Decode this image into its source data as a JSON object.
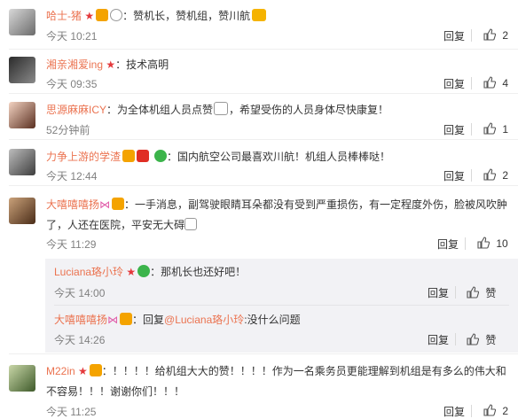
{
  "comments": [
    {
      "name": "哈士-猪",
      "text": "：赞机长，赞机组，赞川航",
      "time": "今天 10:21",
      "reply": "回复",
      "likes": "2"
    },
    {
      "name": "湘亲湘爱ing",
      "text": "：技术高明",
      "time": "今天 09:35",
      "reply": "回复",
      "likes": "4"
    },
    {
      "name": "思源麻麻ICY",
      "text": "：为全体机组人员点赞",
      "text2": "，希望受伤的人员身体尽快康复！",
      "time": "52分钟前",
      "reply": "回复",
      "likes": "1"
    },
    {
      "name": "力争上游的学渣",
      "text": "：国内航空公司最喜欢川航！机组人员棒棒哒！",
      "time": "今天 12:44",
      "reply": "回复",
      "likes": "2"
    },
    {
      "name": "大嘻嘻嘻扬",
      "text": "：一手消息，副驾驶眼睛耳朵都没有受到严重损伤，有一定程度外伤，脸被风吹肿了，人还在医院，平安无大碍",
      "time": "今天 11:29",
      "reply": "回复",
      "likes": "10"
    },
    {
      "name": "M22in",
      "text": "：！！！！给机组大大的赞！！！！作为一名乘务员更能理解到机组是有多么的伟大和不容易！！！谢谢你们！！！",
      "time": "今天 11:25",
      "reply": "回复",
      "likes": "2"
    }
  ],
  "sub_replies": [
    {
      "name": "Luciana珞小玲",
      "text": "：那机长也还好吧！",
      "time": "今天 14:00",
      "reply": "回复",
      "like": "赞"
    },
    {
      "name": "大嘻嘻嘻扬",
      "prefix": "：回复",
      "mention": "@Luciana珞小玲",
      "text": ":没什么问题",
      "time": "今天 14:26",
      "reply": "回复",
      "like": "赞"
    }
  ],
  "icons": {
    "thumb": "thumbs-up-icon",
    "accent": "#eb7350",
    "link": "#eb7350"
  }
}
